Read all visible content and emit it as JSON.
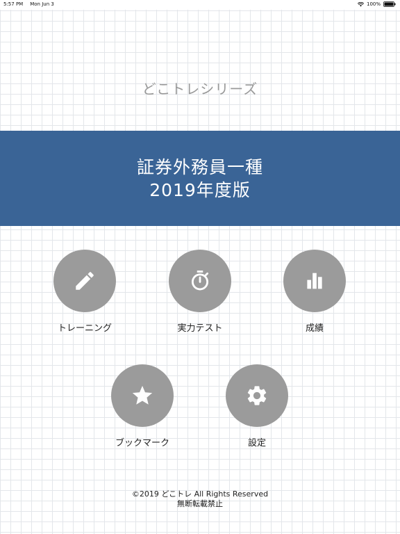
{
  "status_bar": {
    "time": "5:57 PM",
    "date": "Mon Jun 3",
    "battery": "100%"
  },
  "series_title": "どこトレシリーズ",
  "banner": {
    "line1": "証券外務員一種",
    "line2": "2019年度版"
  },
  "menu": {
    "training": {
      "label": "トレーニング",
      "icon": "pencil-icon"
    },
    "exam": {
      "label": "実力テスト",
      "icon": "stopwatch-icon"
    },
    "results": {
      "label": "成績",
      "icon": "bar-chart-icon"
    },
    "bookmark": {
      "label": "ブックマーク",
      "icon": "star-icon"
    },
    "settings": {
      "label": "設定",
      "icon": "gear-icon"
    }
  },
  "footer": {
    "copyright": "©2019 どこトレ All Rights Reserved",
    "notice": "無断転載禁止"
  },
  "colors": {
    "banner": "#3a6496",
    "button": "#9b9b9b",
    "grid": "#e3e6ea"
  }
}
